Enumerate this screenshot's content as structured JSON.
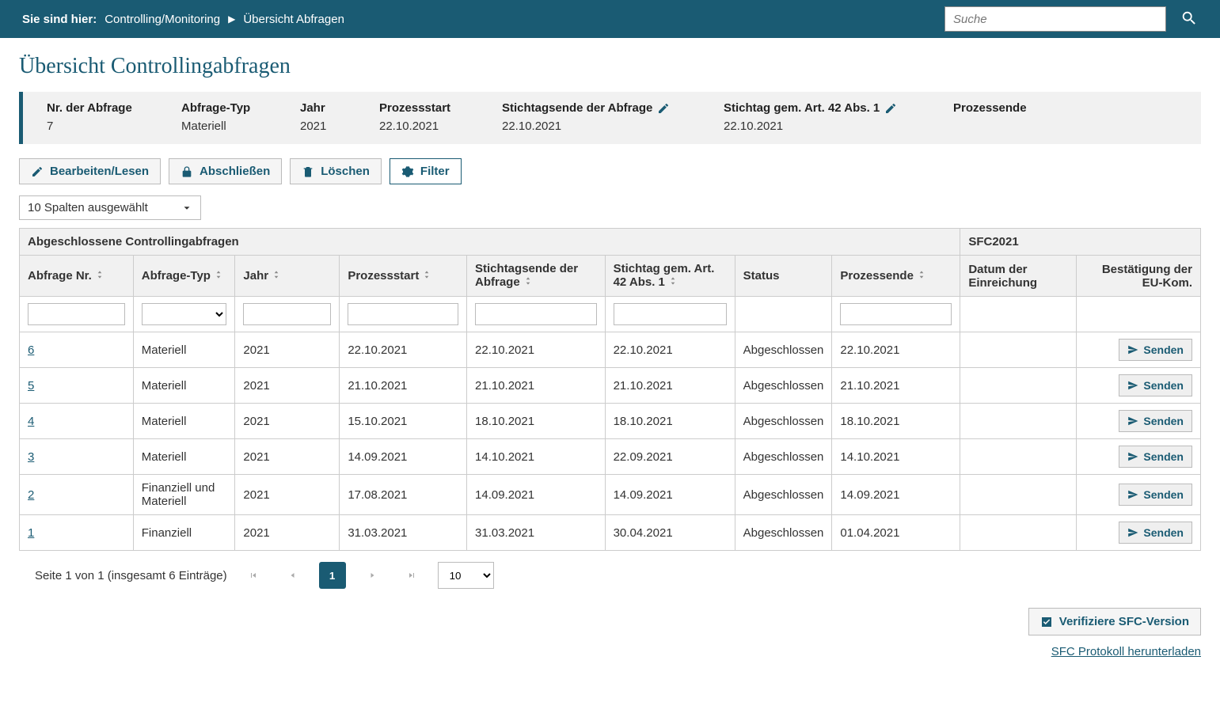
{
  "breadcrumb": {
    "label": "Sie sind hier:",
    "item1": "Controlling/Monitoring",
    "item2": "Übersicht Abfragen"
  },
  "search": {
    "placeholder": "Suche"
  },
  "page_title": "Übersicht Controllingabfragen",
  "detail": {
    "nr_label": "Nr. der Abfrage",
    "nr_value": "7",
    "typ_label": "Abfrage-Typ",
    "typ_value": "Materiell",
    "jahr_label": "Jahr",
    "jahr_value": "2021",
    "start_label": "Prozessstart",
    "start_value": "22.10.2021",
    "stichtag_label": "Stichtagsende der Abfrage",
    "stichtag_value": "22.10.2021",
    "art42_label": "Stichtag gem. Art. 42 Abs. 1",
    "art42_value": "22.10.2021",
    "ende_label": "Prozessende",
    "ende_value": ""
  },
  "toolbar": {
    "edit": "Bearbeiten/Lesen",
    "close": "Abschließen",
    "delete": "Löschen",
    "filter": "Filter"
  },
  "column_select": "10 Spalten ausgewählt",
  "table": {
    "group1": "Abgeschlossene Controllingabfragen",
    "group2": "SFC2021",
    "headers": {
      "nr": "Abfrage Nr.",
      "typ": "Abfrage-Typ",
      "jahr": "Jahr",
      "start": "Prozessstart",
      "stichtag": "Stichtagsende der Abfrage",
      "art42": "Stichtag gem. Art. 42 Abs. 1",
      "status": "Status",
      "ende": "Prozessende",
      "datum": "Datum der Einreichung",
      "bestaetigung": "Bestätigung der EU-Kom."
    },
    "rows": [
      {
        "nr": "6",
        "typ": "Materiell",
        "jahr": "2021",
        "start": "22.10.2021",
        "stichtag": "22.10.2021",
        "art42": "22.10.2021",
        "status": "Abgeschlossen",
        "ende": "22.10.2021",
        "datum": "",
        "send": "Senden"
      },
      {
        "nr": "5",
        "typ": "Materiell",
        "jahr": "2021",
        "start": "21.10.2021",
        "stichtag": "21.10.2021",
        "art42": "21.10.2021",
        "status": "Abgeschlossen",
        "ende": "21.10.2021",
        "datum": "",
        "send": "Senden"
      },
      {
        "nr": "4",
        "typ": "Materiell",
        "jahr": "2021",
        "start": "15.10.2021",
        "stichtag": "18.10.2021",
        "art42": "18.10.2021",
        "status": "Abgeschlossen",
        "ende": "18.10.2021",
        "datum": "",
        "send": "Senden"
      },
      {
        "nr": "3",
        "typ": "Materiell",
        "jahr": "2021",
        "start": "14.09.2021",
        "stichtag": "14.10.2021",
        "art42": "22.09.2021",
        "status": "Abgeschlossen",
        "ende": "14.10.2021",
        "datum": "",
        "send": "Senden"
      },
      {
        "nr": "2",
        "typ": "Finanziell und Materiell",
        "jahr": "2021",
        "start": "17.08.2021",
        "stichtag": "14.09.2021",
        "art42": "14.09.2021",
        "status": "Abgeschlossen",
        "ende": "14.09.2021",
        "datum": "",
        "send": "Senden"
      },
      {
        "nr": "1",
        "typ": "Finanziell",
        "jahr": "2021",
        "start": "31.03.2021",
        "stichtag": "31.03.2021",
        "art42": "30.04.2021",
        "status": "Abgeschlossen",
        "ende": "01.04.2021",
        "datum": "",
        "send": "Senden"
      }
    ]
  },
  "pager": {
    "summary": "Seite 1 von 1 (insgesamt 6 Einträge)",
    "current": "1",
    "page_size": "10"
  },
  "bottom": {
    "verify": "Verifiziere SFC-Version",
    "download": "SFC Protokoll herunterladen"
  }
}
